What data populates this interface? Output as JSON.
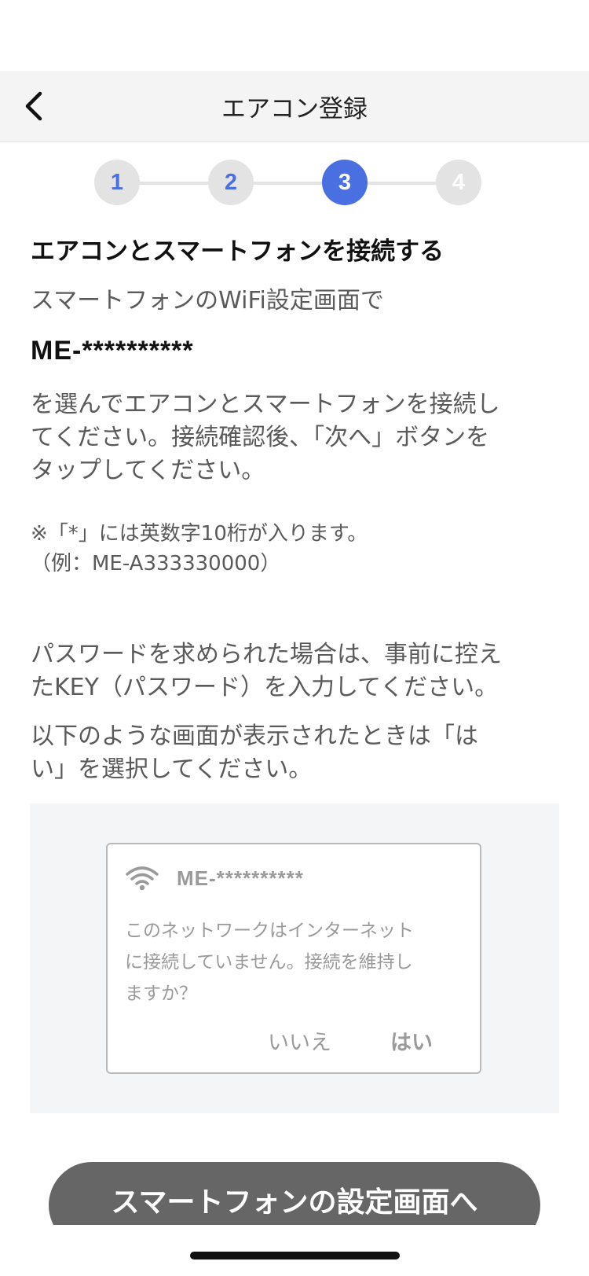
{
  "nav": {
    "title": "エアコン登録",
    "back_icon": "chevron-left-icon"
  },
  "stepper": {
    "current": 3,
    "steps": [
      "1",
      "2",
      "3",
      "4"
    ],
    "active_color": "#4a6fe0",
    "inactive_color": "#e3e3e3"
  },
  "content": {
    "heading": "エアコンとスマートフォンを接続する",
    "instruction_1": "スマートフォンのWiFi設定画面で",
    "ssid": "ME-**********",
    "instruction_2_line1": "を選んでエアコンとスマートフォンを接続し",
    "instruction_2_line2": "てください。接続確認後、「次へ」ボタンを",
    "instruction_2_line3": "タップしてください。",
    "note_line1": "※「*」には英数字10桁が入ります。",
    "note_line2": "（例：ME-A333330000）",
    "password_line1": "パスワードを求められた場合は、事前に控え",
    "password_line2": "たKEY（パスワード）を入力してください。",
    "select_line1": "以下のような画面が表示されたときは「は",
    "select_line2": "い」を選択してください。"
  },
  "dialog_example": {
    "wifi_icon": "wifi-icon",
    "ssid": "ME-**********",
    "message_line1": "このネットワークはインターネット",
    "message_line2": "に接続していません。接続を維持し",
    "message_line3": "ますか？",
    "no_label": "いいえ",
    "yes_label": "はい"
  },
  "cta": {
    "label": "スマートフォンの設定画面へ",
    "color": "#666666"
  }
}
